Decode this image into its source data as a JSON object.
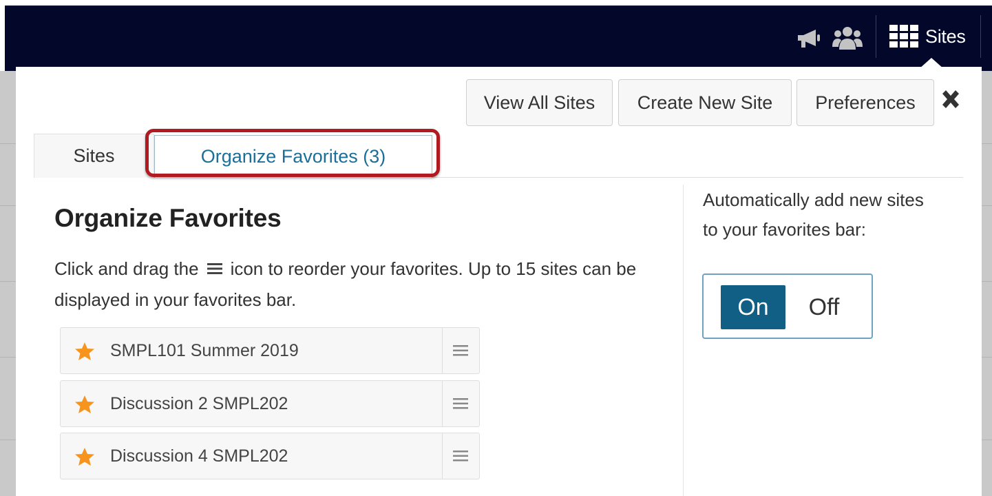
{
  "topnav": {
    "sites_label": "Sites",
    "icons": [
      "announcements-icon",
      "group-icon",
      "grid-icon"
    ]
  },
  "panel": {
    "buttons": {
      "view_all": "View All Sites",
      "create_new": "Create New Site",
      "preferences": "Preferences"
    },
    "tabs": {
      "sites": "Sites",
      "organize": "Organize Favorites (3)",
      "active": "organize"
    },
    "heading": "Organize Favorites",
    "description_before": "Click and drag the",
    "description_after": "icon to reorder your favorites. Up to 15 sites can be displayed in your favorites bar.",
    "favorites": [
      {
        "name": "SMPL101 Summer 2019"
      },
      {
        "name": "Discussion 2 SMPL202"
      },
      {
        "name": "Discussion 4 SMPL202"
      }
    ],
    "auto_add": {
      "label": "Automatically add new sites to your favorites bar:",
      "on": "On",
      "off": "Off",
      "selected": "On"
    }
  },
  "colors": {
    "topbar": "#03082b",
    "accent": "#125f85",
    "star": "#f7941d",
    "highlight": "#b01b22"
  }
}
